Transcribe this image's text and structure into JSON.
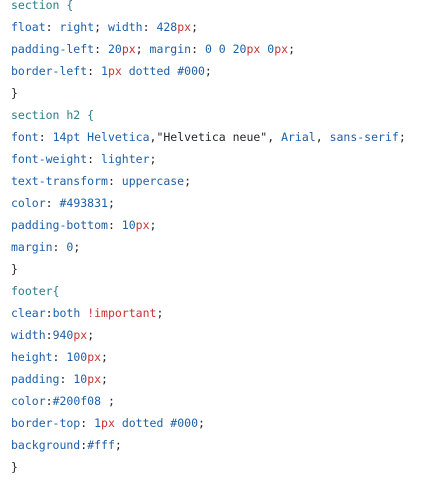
{
  "colors": {
    "selector": "#2b7d8a",
    "property": "#1d5fa8",
    "value": "#1d5fa8",
    "unit": "#c8322f",
    "punct": "#1f2328",
    "background": "#ffffff"
  },
  "lines": [
    [
      {
        "t": "section {",
        "c": "selector"
      }
    ],
    [
      {
        "t": "float",
        "c": "property"
      },
      {
        "t": ": ",
        "c": "punct"
      },
      {
        "t": "right",
        "c": "value"
      },
      {
        "t": "; ",
        "c": "punct"
      },
      {
        "t": "width",
        "c": "property"
      },
      {
        "t": ": ",
        "c": "punct"
      },
      {
        "t": "428",
        "c": "value"
      },
      {
        "t": "px",
        "c": "unit"
      },
      {
        "t": ";",
        "c": "punct"
      }
    ],
    [
      {
        "t": "padding-left",
        "c": "property"
      },
      {
        "t": ": ",
        "c": "punct"
      },
      {
        "t": "20",
        "c": "value"
      },
      {
        "t": "px",
        "c": "unit"
      },
      {
        "t": "; ",
        "c": "punct"
      },
      {
        "t": "margin",
        "c": "property"
      },
      {
        "t": ": ",
        "c": "punct"
      },
      {
        "t": "0 0 20",
        "c": "value"
      },
      {
        "t": "px",
        "c": "unit"
      },
      {
        "t": " ",
        "c": "punct"
      },
      {
        "t": "0",
        "c": "value"
      },
      {
        "t": "px",
        "c": "unit"
      },
      {
        "t": ";",
        "c": "punct"
      }
    ],
    [
      {
        "t": "border-left",
        "c": "property"
      },
      {
        "t": ": ",
        "c": "punct"
      },
      {
        "t": "1",
        "c": "value"
      },
      {
        "t": "px",
        "c": "unit"
      },
      {
        "t": " dotted #000",
        "c": "value"
      },
      {
        "t": ";",
        "c": "punct"
      }
    ],
    [
      {
        "t": "}",
        "c": "punct"
      }
    ],
    [
      {
        "t": "section h2 {",
        "c": "selector"
      }
    ],
    [
      {
        "t": "font",
        "c": "property"
      },
      {
        "t": ": ",
        "c": "punct"
      },
      {
        "t": "14pt Helvetica",
        "c": "value"
      },
      {
        "t": ",",
        "c": "punct"
      },
      {
        "t": "\"Helvetica neue\"",
        "c": "string"
      },
      {
        "t": ", ",
        "c": "punct"
      },
      {
        "t": "Arial",
        "c": "value"
      },
      {
        "t": ", ",
        "c": "punct"
      },
      {
        "t": "sans-serif",
        "c": "value"
      },
      {
        "t": ";",
        "c": "punct"
      }
    ],
    [
      {
        "t": "font-weight",
        "c": "property"
      },
      {
        "t": ": ",
        "c": "punct"
      },
      {
        "t": "lighter",
        "c": "value"
      },
      {
        "t": ";",
        "c": "punct"
      }
    ],
    [
      {
        "t": "text-transform",
        "c": "property"
      },
      {
        "t": ": ",
        "c": "punct"
      },
      {
        "t": "uppercase",
        "c": "value"
      },
      {
        "t": ";",
        "c": "punct"
      }
    ],
    [
      {
        "t": "color",
        "c": "property"
      },
      {
        "t": ": ",
        "c": "punct"
      },
      {
        "t": "#493831",
        "c": "value"
      },
      {
        "t": ";",
        "c": "punct"
      }
    ],
    [
      {
        "t": "padding-bottom",
        "c": "property"
      },
      {
        "t": ": ",
        "c": "punct"
      },
      {
        "t": "10",
        "c": "value"
      },
      {
        "t": "px",
        "c": "unit"
      },
      {
        "t": ";",
        "c": "punct"
      }
    ],
    [
      {
        "t": "margin",
        "c": "property"
      },
      {
        "t": ": ",
        "c": "punct"
      },
      {
        "t": "0",
        "c": "value"
      },
      {
        "t": ";",
        "c": "punct"
      }
    ],
    [
      {
        "t": "}",
        "c": "punct"
      }
    ],
    [
      {
        "t": "footer{",
        "c": "selector"
      }
    ],
    [
      {
        "t": "clear",
        "c": "property"
      },
      {
        "t": ":",
        "c": "punct"
      },
      {
        "t": "both ",
        "c": "value"
      },
      {
        "t": "!important",
        "c": "unit"
      },
      {
        "t": ";",
        "c": "punct"
      }
    ],
    [
      {
        "t": "width",
        "c": "property"
      },
      {
        "t": ":",
        "c": "punct"
      },
      {
        "t": "940",
        "c": "value"
      },
      {
        "t": "px",
        "c": "unit"
      },
      {
        "t": ";",
        "c": "punct"
      }
    ],
    [
      {
        "t": "height",
        "c": "property"
      },
      {
        "t": ": ",
        "c": "punct"
      },
      {
        "t": "100",
        "c": "value"
      },
      {
        "t": "px",
        "c": "unit"
      },
      {
        "t": ";",
        "c": "punct"
      }
    ],
    [
      {
        "t": "padding",
        "c": "property"
      },
      {
        "t": ": ",
        "c": "punct"
      },
      {
        "t": "10",
        "c": "value"
      },
      {
        "t": "px",
        "c": "unit"
      },
      {
        "t": ";",
        "c": "punct"
      }
    ],
    [
      {
        "t": "color",
        "c": "property"
      },
      {
        "t": ":",
        "c": "punct"
      },
      {
        "t": "#200f08",
        "c": "value"
      },
      {
        "t": " ;",
        "c": "punct"
      }
    ],
    [
      {
        "t": "border-top",
        "c": "property"
      },
      {
        "t": ": ",
        "c": "punct"
      },
      {
        "t": "1",
        "c": "value"
      },
      {
        "t": "px",
        "c": "unit"
      },
      {
        "t": " dotted #000",
        "c": "value"
      },
      {
        "t": ";",
        "c": "punct"
      }
    ],
    [
      {
        "t": "background",
        "c": "property"
      },
      {
        "t": ":",
        "c": "punct"
      },
      {
        "t": "#fff",
        "c": "value"
      },
      {
        "t": ";",
        "c": "punct"
      }
    ],
    [
      {
        "t": "}",
        "c": "punct"
      }
    ]
  ]
}
